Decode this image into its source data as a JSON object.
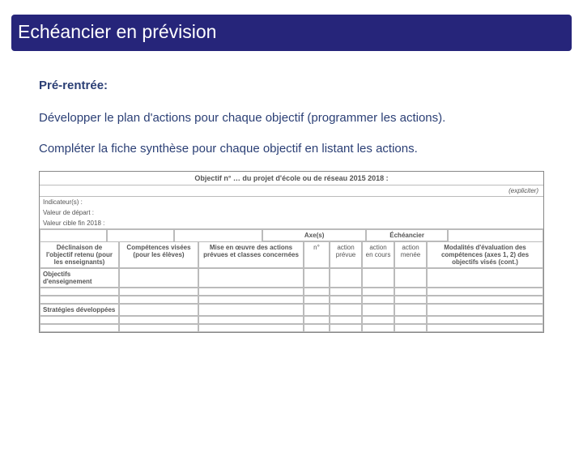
{
  "title": "Echéancier en prévision",
  "subhead": "Pré-rentrée:",
  "paragraphs": {
    "p1": "Développer le plan d'actions pour chaque objectif (programmer  les actions).",
    "p2": "Compléter la fiche synthèse pour chaque objectif en listant les actions."
  },
  "sheet": {
    "objectif_title": "Objectif n° … du projet d'école ou de réseau 2015 2018 :",
    "expliciter": "(expliciter)",
    "fields": {
      "indicateurs_label": "Indicateur(s) :",
      "valeur_depart_label": "Valeur de départ :",
      "valeur_cible_label": "Valeur cible fin 2018 :"
    },
    "group_headers": {
      "axes": "Axe(s)",
      "echeancier": "Échéancier"
    },
    "columns": {
      "declinaison": "Déclinaison de l'objectif retenu (pour les enseignants)",
      "competences": "Compétences visées (pour les élèves)",
      "mise_en_oeuvre": "Mise en œuvre des actions prévues et classes concernées",
      "axes_num": "n°",
      "ech_prevue": "action prévue",
      "ech_en_cours": "action en cours",
      "ech_menee": "action menée",
      "modalites": "Modalités d'évaluation des compétences (axes 1, 2) des objectifs visés (cont.)"
    },
    "side_labels": {
      "objectifs_enseignement": "Objectifs d'enseignement",
      "strategies": "Stratégies développées"
    }
  },
  "chart_data": {
    "type": "table",
    "title": "Objectif n° … du projet d'école ou de réseau 2015 2018 :",
    "metadata_fields": [
      {
        "label": "Indicateur(s) :",
        "value": ""
      },
      {
        "label": "Valeur de départ :",
        "value": ""
      },
      {
        "label": "Valeur cible fin 2018 :",
        "value": ""
      }
    ],
    "column_groups": [
      {
        "label": "",
        "span": 1
      },
      {
        "label": "",
        "span": 1
      },
      {
        "label": "",
        "span": 1
      },
      {
        "label": "Axe(s)",
        "span": 1
      },
      {
        "label": "Échéancier",
        "span": 3
      },
      {
        "label": "",
        "span": 1
      }
    ],
    "columns": [
      "Déclinaison de l'objectif retenu (pour les enseignants)",
      "Compétences visées (pour les élèves)",
      "Mise en œuvre des actions prévues et classes concernées",
      "n°",
      "action prévue",
      "action en cours",
      "action menée",
      "Modalités d'évaluation des compétences (axes 1, 2) des objectifs visés (cont.)"
    ],
    "row_group_labels": [
      "Objectifs d'enseignement",
      "Stratégies développées"
    ],
    "rows": [
      [
        "",
        "",
        "",
        "",
        "",
        "",
        "",
        ""
      ],
      [
        "",
        "",
        "",
        "",
        "",
        "",
        "",
        ""
      ],
      [
        "",
        "",
        "",
        "",
        "",
        "",
        "",
        ""
      ],
      [
        "",
        "",
        "",
        "",
        "",
        "",
        "",
        ""
      ],
      [
        "",
        "",
        "",
        "",
        "",
        "",
        "",
        ""
      ],
      [
        "",
        "",
        "",
        "",
        "",
        "",
        "",
        ""
      ]
    ]
  }
}
